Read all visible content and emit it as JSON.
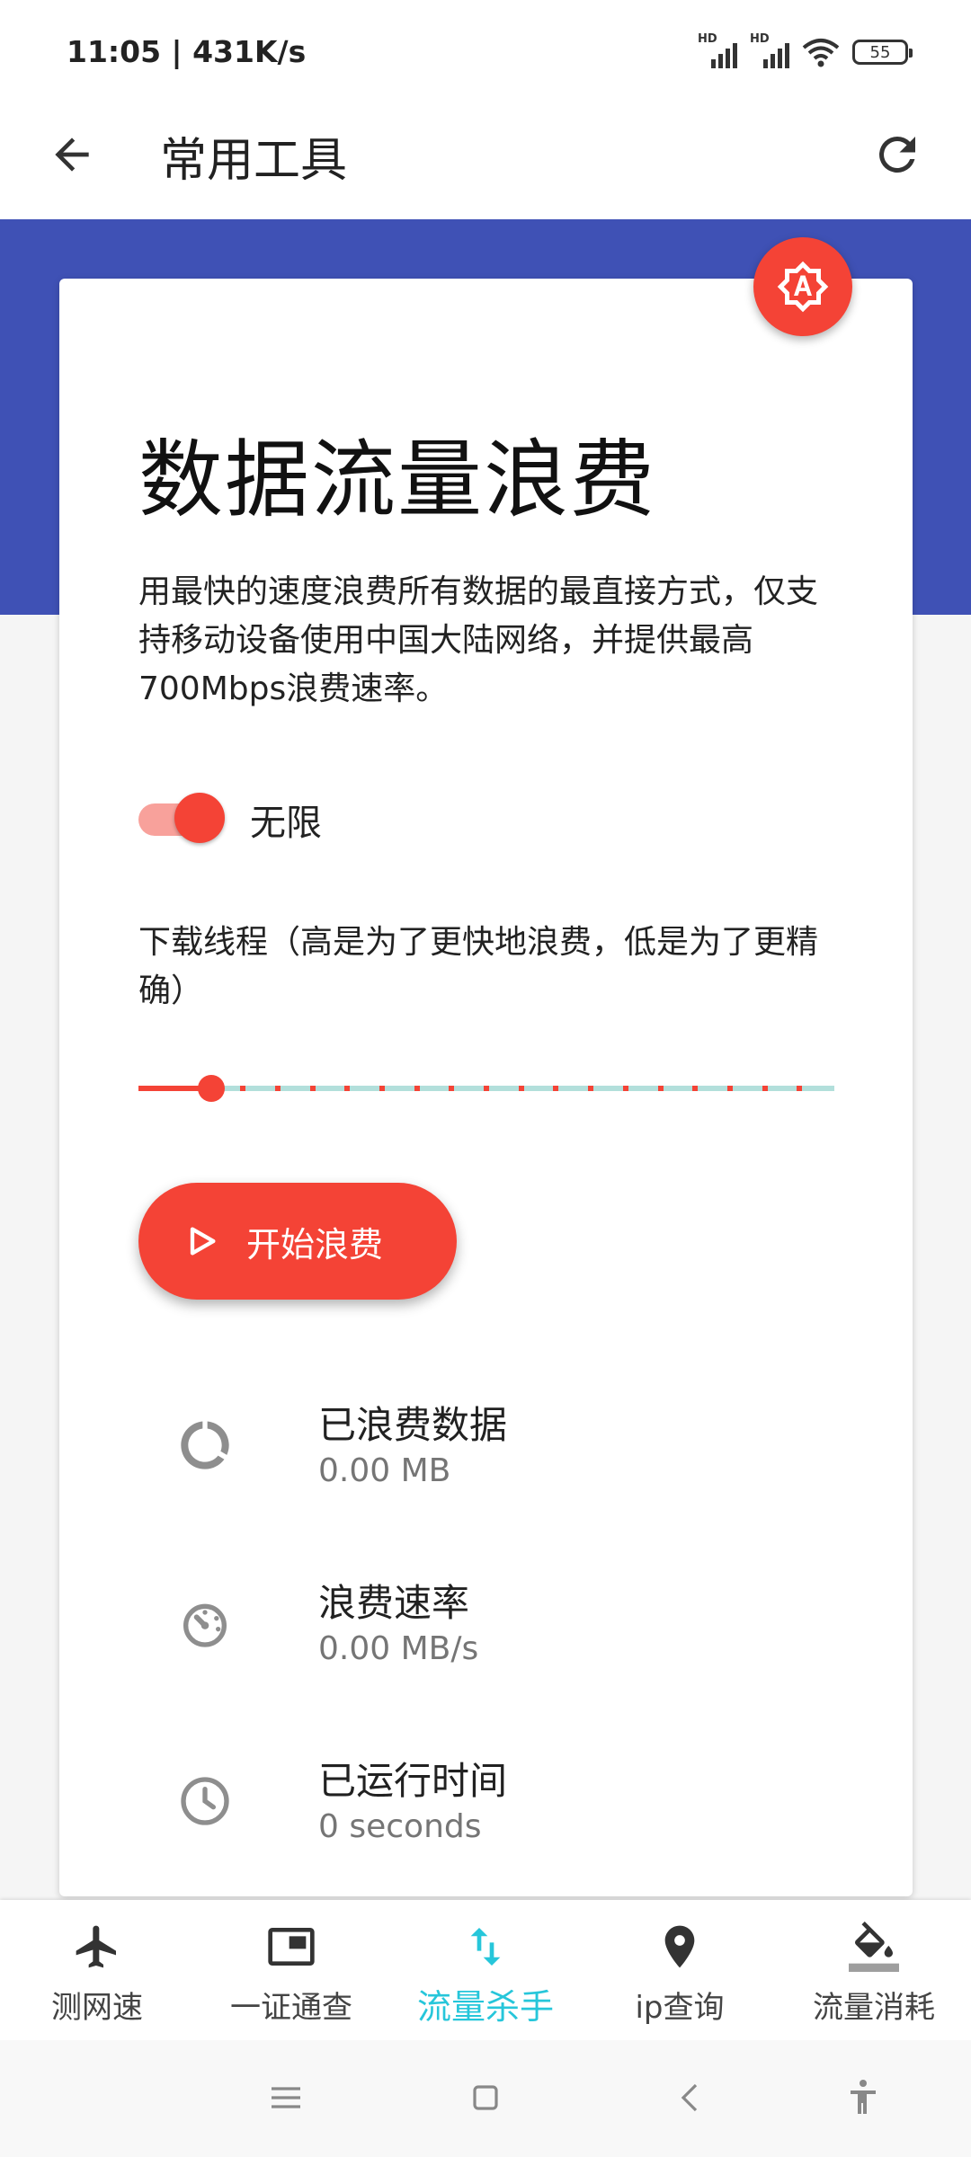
{
  "status": {
    "time_speed": "11:05 | 431K/s",
    "sim1_label": "HD",
    "sim2_label": "HD",
    "battery": "55"
  },
  "appbar": {
    "title": "常用工具",
    "back_icon": "arrow-back-icon",
    "refresh_icon": "refresh-icon"
  },
  "card": {
    "badge_icon": "brightness-auto-icon",
    "title": "数据流量浪费",
    "description": "用最快的速度浪费所有数据的最直接方式，仅支持移动设备使用中国大陆网络，并提供最高700Mbps浪费速率。",
    "unlimited_toggle": {
      "label": "无限",
      "on": true
    },
    "threads": {
      "label": "下载线程（高是为了更快地浪费，低是为了更精确）",
      "value_fraction": 0.105,
      "steps": 20
    },
    "start_button": {
      "label": "开始浪费",
      "icon": "play-icon"
    },
    "stats": [
      {
        "name": "已浪费数据",
        "value": "0.00 MB",
        "icon": "data-usage-icon"
      },
      {
        "name": "浪费速率",
        "value": "0.00 MB/s",
        "icon": "speedometer-icon"
      },
      {
        "name": "已运行时间",
        "value": "0 seconds",
        "icon": "clock-icon"
      }
    ]
  },
  "bottom_nav": {
    "items": [
      {
        "label": "测网速",
        "icon": "airplane-icon",
        "active": false
      },
      {
        "label": "一证通查",
        "icon": "picture-in-picture-icon",
        "active": false
      },
      {
        "label": "流量杀手",
        "icon": "swap-vertical-icon",
        "active": true
      },
      {
        "label": "ip查询",
        "icon": "location-pin-icon",
        "active": false
      },
      {
        "label": "流量消耗",
        "icon": "paint-bucket-icon",
        "active": false
      }
    ]
  },
  "colors": {
    "primary": "#3f51b5",
    "accent": "#f44336",
    "active_nav": "#26c6da"
  }
}
